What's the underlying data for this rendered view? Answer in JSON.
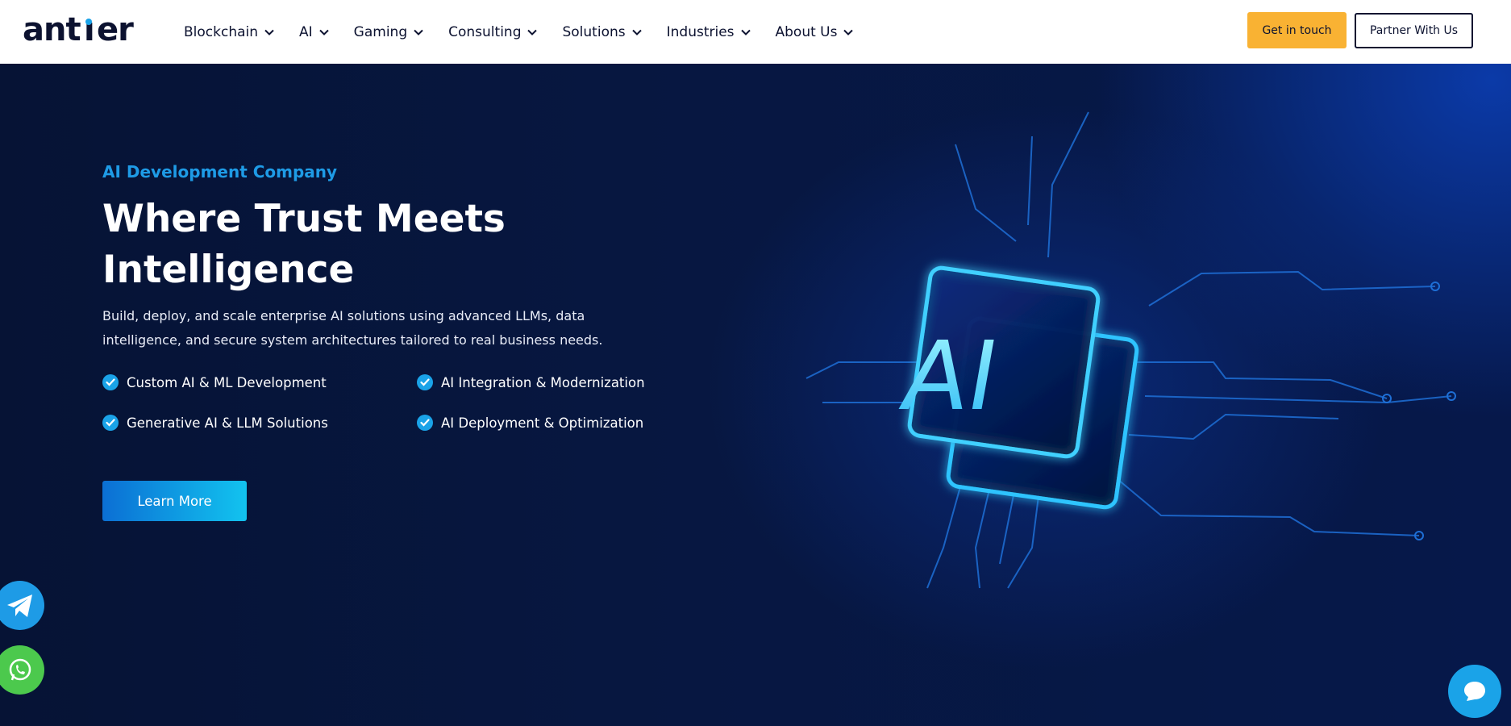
{
  "brand": {
    "logo_text": "antier",
    "accent": "#1aa3e8",
    "dark": "#0c1230"
  },
  "nav": {
    "items": [
      {
        "label": "Blockchain"
      },
      {
        "label": "AI"
      },
      {
        "label": "Gaming"
      },
      {
        "label": "Consulting"
      },
      {
        "label": "Solutions"
      },
      {
        "label": "Industries"
      },
      {
        "label": "About Us"
      }
    ],
    "cta_primary": "Get in touch",
    "cta_secondary": "Partner With Us"
  },
  "hero": {
    "eyebrow": "AI Development Company",
    "title": "Where Trust Meets Intelligence",
    "description": "Build, deploy, and scale enterprise AI solutions using advanced LLMs, data intelligence, and secure system architectures tailored to real business needs.",
    "features": [
      "Custom AI & ML Development",
      "AI Integration & Modernization",
      "Generative AI & LLM Solutions",
      "AI Deployment & Optimization"
    ],
    "button_label": "Learn More",
    "art_label": "AI"
  },
  "floating": {
    "telegram_icon": "telegram-icon",
    "whatsapp_icon": "whatsapp-icon",
    "chat_icon": "chat-bubble-icon"
  }
}
